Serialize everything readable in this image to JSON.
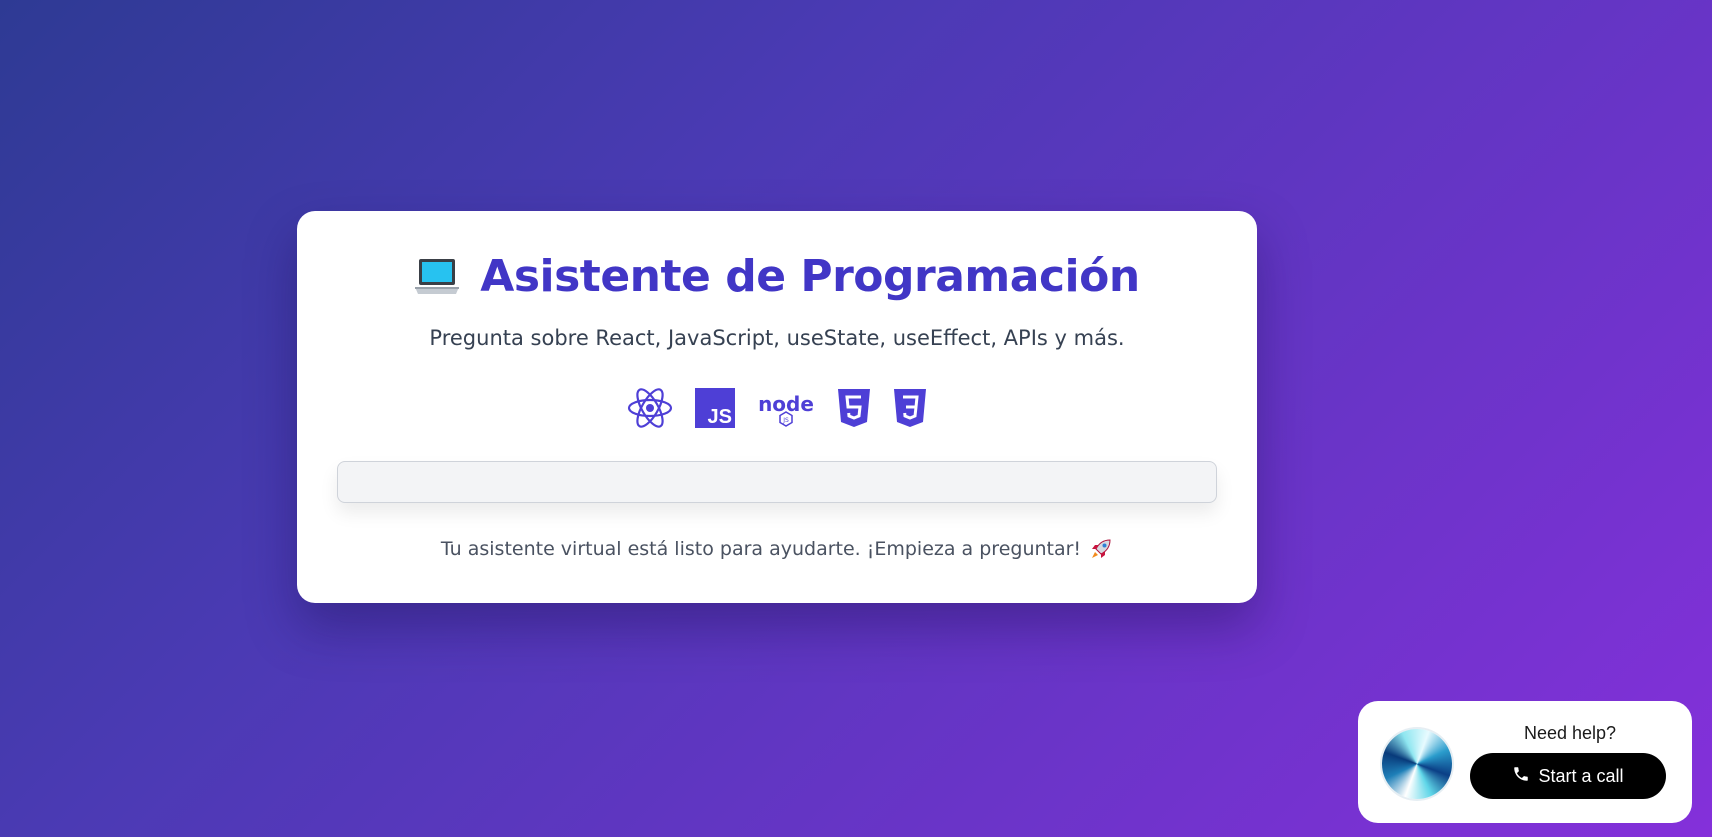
{
  "header": {
    "title": "Asistente de Programación",
    "title_icon": "laptop-icon",
    "subtitle": "Pregunta sobre React, JavaScript, useState, useEffect, APIs y más."
  },
  "tech_icons": [
    "react-icon",
    "javascript-icon",
    "nodejs-icon",
    "html5-icon",
    "css3-icon"
  ],
  "chat": {
    "input_value": "",
    "input_placeholder": ""
  },
  "status": {
    "message": "Tu asistente virtual está listo para ayudarte. ¡Empieza a preguntar!",
    "icon": "rocket-icon"
  },
  "help_widget": {
    "heading": "Need help?",
    "button_label": "Start a call",
    "button_icon": "phone-icon"
  },
  "colors": {
    "accent": "#4136c6",
    "background_start": "#2e3a94",
    "background_end": "#8430da",
    "button": "#000000"
  }
}
